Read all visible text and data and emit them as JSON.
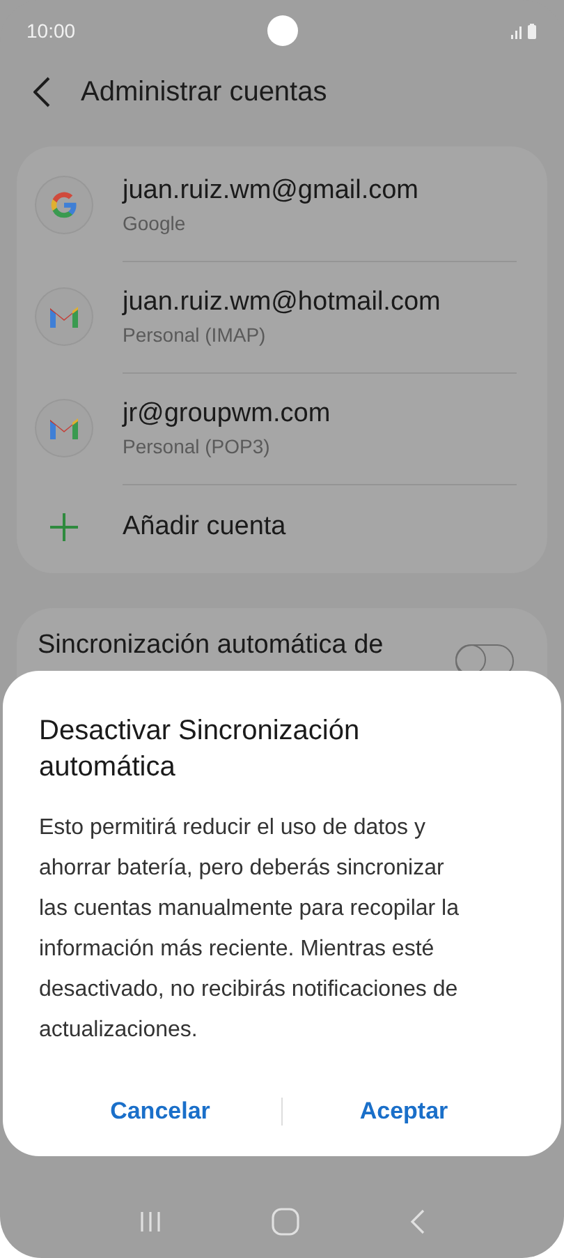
{
  "status_bar": {
    "time": "10:00"
  },
  "header": {
    "title": "Administrar cuentas"
  },
  "accounts": [
    {
      "kind": "google",
      "email": "juan.ruiz.wm@gmail.com",
      "type": "Google"
    },
    {
      "kind": "mail",
      "email": "juan.ruiz.wm@hotmail.com",
      "type": "Personal (IMAP)"
    },
    {
      "kind": "mail",
      "email": "jr@groupwm.com",
      "type": "Personal (POP3)"
    }
  ],
  "add_account": {
    "label": "Añadir cuenta"
  },
  "sync_setting": {
    "label": "Sincronización automática de",
    "on": false
  },
  "dialog": {
    "title": "Desactivar Sincronización automática",
    "message": "Esto permitirá reducir el uso de datos y ahorrar batería, pero deberás sincronizar las cuentas manualmente para recopilar la información más reciente. Mientras esté desactivado, no recibirás notificaciones de actualizaciones.",
    "buttons": [
      "Cancelar",
      "Aceptar"
    ]
  }
}
